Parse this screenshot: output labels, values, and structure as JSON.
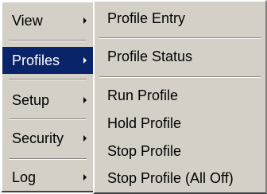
{
  "main_menu": {
    "items": [
      {
        "label": "View"
      },
      {
        "label": "Profiles"
      },
      {
        "label": "Setup"
      },
      {
        "label": "Security"
      },
      {
        "label": "Log"
      }
    ]
  },
  "sub_menu": {
    "items": [
      {
        "label": "Profile Entry"
      },
      {
        "label": "Profile Status"
      },
      {
        "label": "Run Profile"
      },
      {
        "label": "Hold Profile"
      },
      {
        "label": "Stop Profile"
      },
      {
        "label": "Stop Profile (All Off)"
      }
    ]
  },
  "colors": {
    "menu_background": "#d4d0c8",
    "selection_background": "#0a246a",
    "selection_text": "#ffffff"
  },
  "icons": [
    "submenu-arrow-icon"
  ]
}
